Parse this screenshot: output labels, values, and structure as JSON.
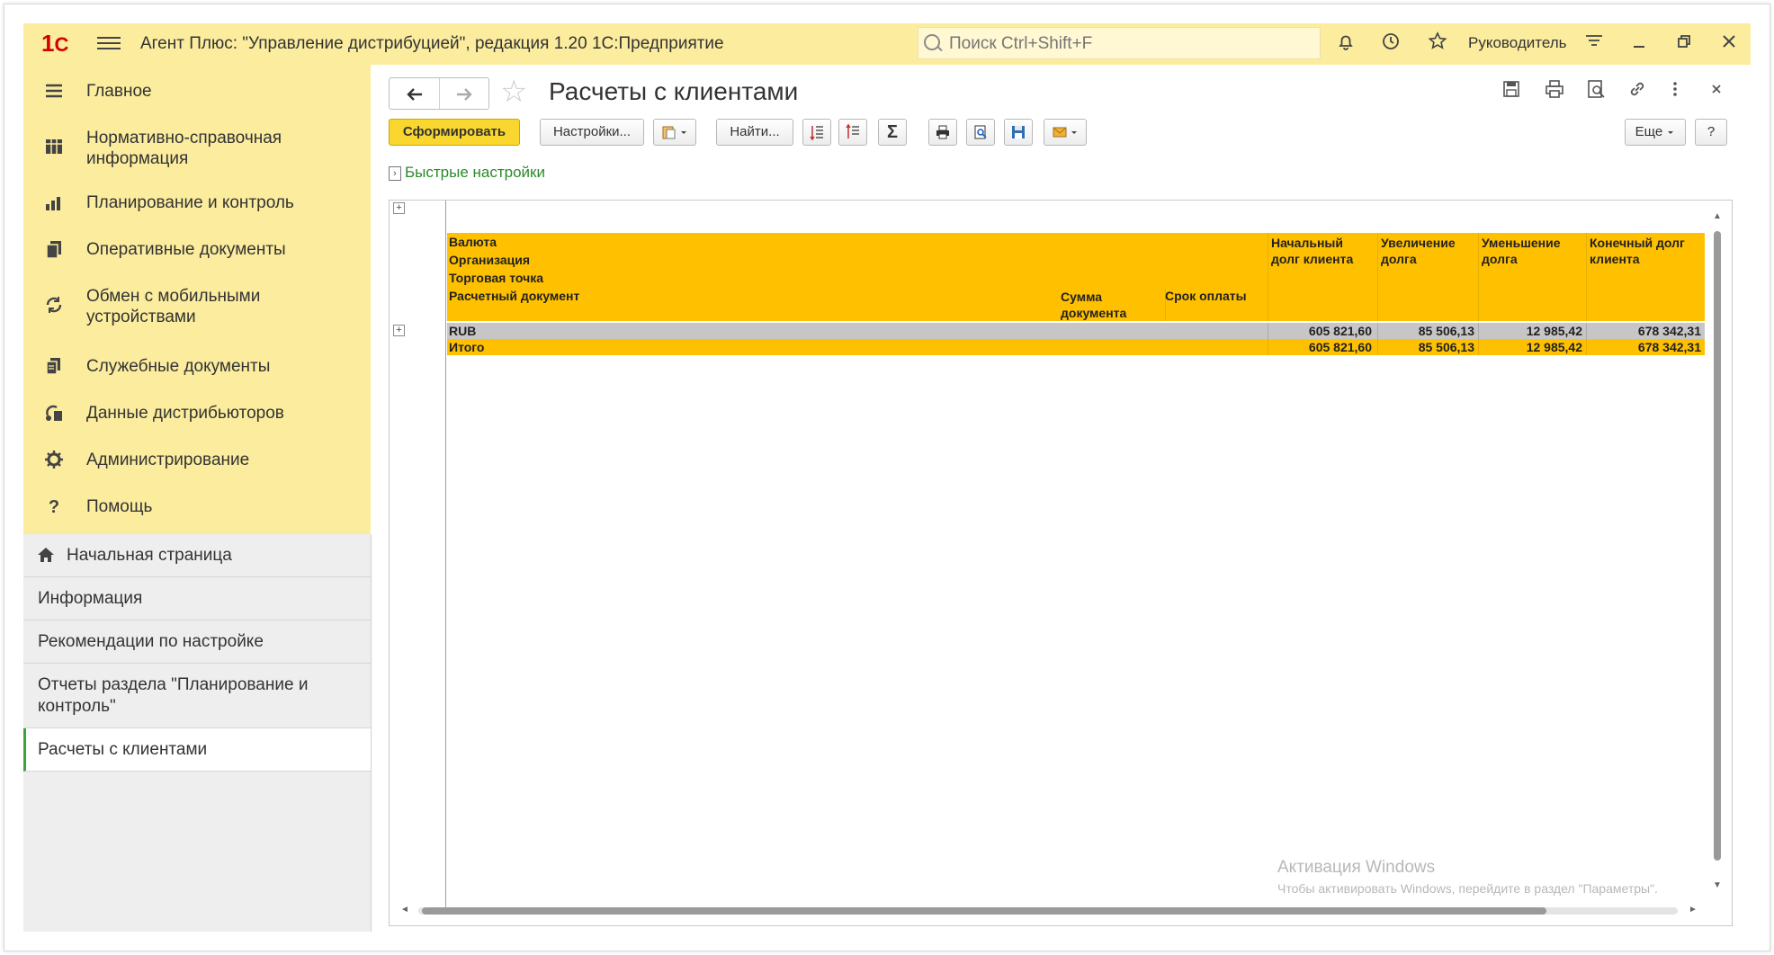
{
  "app": {
    "title": "Агент Плюс: \"Управление дистрибуцией\", редакция 1.20 1С:Предприятие",
    "logo": "1С",
    "search_placeholder": "Поиск Ctrl+Shift+F",
    "user": "Руководитель"
  },
  "sidebar": {
    "items": [
      {
        "label": "Главное",
        "icon": "menu-icon"
      },
      {
        "label": "Нормативно-справочная информация",
        "icon": "grid-icon"
      },
      {
        "label": "Планирование и контроль",
        "icon": "bar-chart-icon"
      },
      {
        "label": "Оперативные документы",
        "icon": "documents-icon"
      },
      {
        "label": "Обмен с мобильными устройствами",
        "icon": "sync-icon"
      },
      {
        "label": "Служебные документы",
        "icon": "service-docs-icon"
      },
      {
        "label": "Данные дистрибьюторов",
        "icon": "distributors-icon"
      },
      {
        "label": "Администрирование",
        "icon": "gear-icon"
      },
      {
        "label": "Помощь",
        "icon": "help-icon"
      }
    ]
  },
  "open_windows": {
    "items": [
      {
        "label": "Начальная страница",
        "icon": "home-icon"
      },
      {
        "label": "Информация"
      },
      {
        "label": "Рекомендации по настройке"
      },
      {
        "label": "Отчеты раздела \"Планирование и контроль\""
      },
      {
        "label": "Расчеты с клиентами",
        "active": true
      }
    ]
  },
  "page": {
    "title": "Расчеты с клиентами"
  },
  "toolbar": {
    "generate": "Сформировать",
    "settings": "Настройки...",
    "find": "Найти...",
    "more": "Еще",
    "help": "?",
    "sum_symbol": "Σ"
  },
  "quick_settings": "Быстрые настройки",
  "report": {
    "header_left": [
      "Валюта",
      "Организация",
      "Торговая точка",
      "Расчетный документ"
    ],
    "header_sum": "Сумма документа",
    "header_due": "Срок оплаты",
    "columns": [
      "Начальный долг клиента",
      "Увеличение долга",
      "Уменьшение долга",
      "Конечный долг клиента"
    ],
    "rows": [
      {
        "label": "RUB",
        "values": [
          "605 821,60",
          "85 506,13",
          "12 985,42",
          "678 342,31"
        ]
      },
      {
        "label": "Итого",
        "values": [
          "605 821,60",
          "85 506,13",
          "12 985,42",
          "678 342,31"
        ]
      }
    ],
    "colors": {
      "header": "#ffc000",
      "group_row": "#c6c6c6",
      "total_row": "#ffc000"
    }
  },
  "watermark": {
    "line1": "Активация Windows",
    "line2": "Чтобы активировать Windows, перейдите в раздел \"Параметры\"."
  }
}
